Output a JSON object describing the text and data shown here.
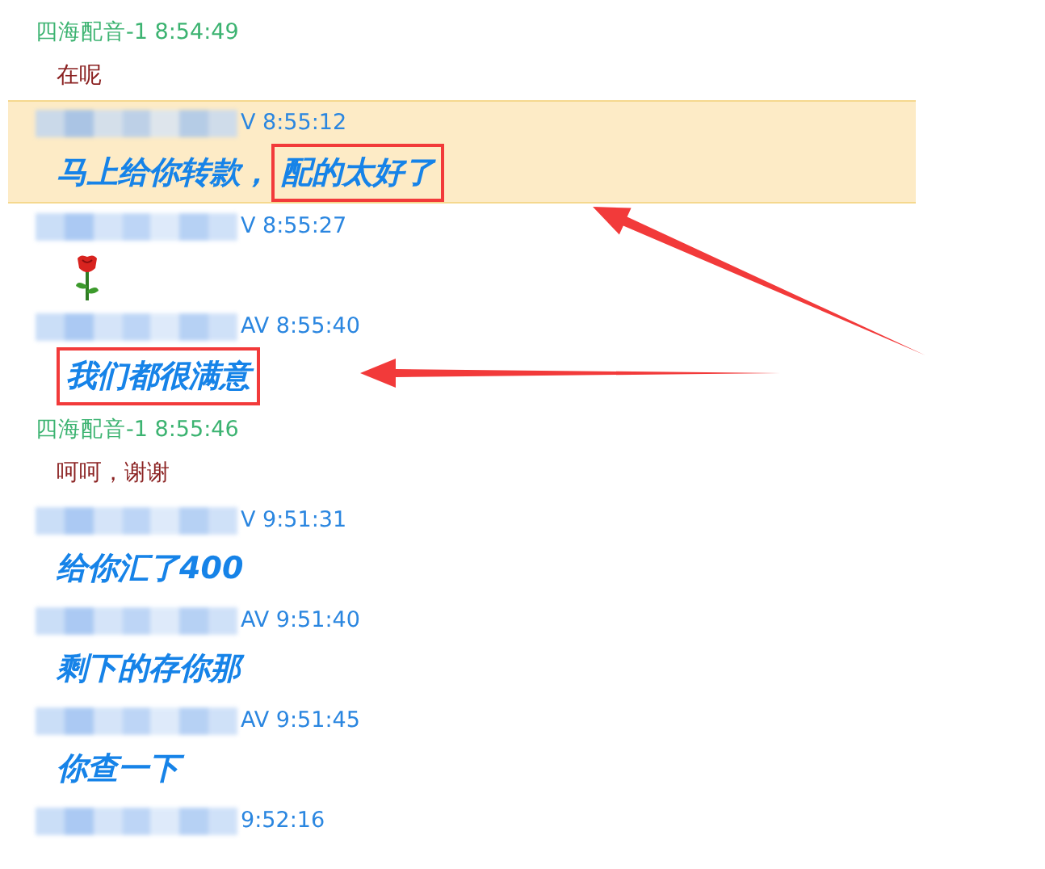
{
  "messages": [
    {
      "header": {
        "kind": "self",
        "name": "四海配音-1",
        "time": "8:54:49"
      },
      "kind": "text",
      "selected": false,
      "parts": [
        {
          "text": "在呢",
          "boxed": false,
          "arrow": false
        }
      ]
    },
    {
      "header": {
        "kind": "other",
        "name_tail": "V",
        "time": "8:55:12"
      },
      "kind": "text",
      "selected": true,
      "parts": [
        {
          "text": "马上给你转款，",
          "boxed": false,
          "arrow": false
        },
        {
          "text": "配的太好了",
          "boxed": true,
          "arrow": true
        }
      ]
    },
    {
      "header": {
        "kind": "other",
        "name_tail": "V",
        "time": "8:55:27"
      },
      "kind": "rose",
      "selected": false
    },
    {
      "header": {
        "kind": "other",
        "name_tail": "AV",
        "time": "8:55:40"
      },
      "kind": "text",
      "selected": false,
      "parts": [
        {
          "text": "我们都很满意",
          "boxed": true,
          "arrow": true
        }
      ]
    },
    {
      "header": {
        "kind": "self",
        "name": "四海配音-1",
        "time": "8:55:46"
      },
      "kind": "text",
      "selected": false,
      "parts": [
        {
          "text": "呵呵，谢谢",
          "boxed": false,
          "arrow": false
        }
      ]
    },
    {
      "header": {
        "kind": "other",
        "name_tail": "V",
        "time": "9:51:31"
      },
      "kind": "text",
      "selected": false,
      "parts": [
        {
          "text": "给你汇了400",
          "boxed": false,
          "arrow": false
        }
      ]
    },
    {
      "header": {
        "kind": "other",
        "name_tail": "AV",
        "time": "9:51:40"
      },
      "kind": "text",
      "selected": false,
      "parts": [
        {
          "text": "剩下的存你那",
          "boxed": false,
          "arrow": false
        }
      ]
    },
    {
      "header": {
        "kind": "other",
        "name_tail": "AV",
        "time": "9:51:45"
      },
      "kind": "text",
      "selected": false,
      "parts": [
        {
          "text": "你查一下",
          "boxed": false,
          "arrow": false
        }
      ]
    },
    {
      "header": {
        "kind": "other",
        "time": "9:52:16"
      },
      "kind": "header_only",
      "selected": false
    }
  ]
}
